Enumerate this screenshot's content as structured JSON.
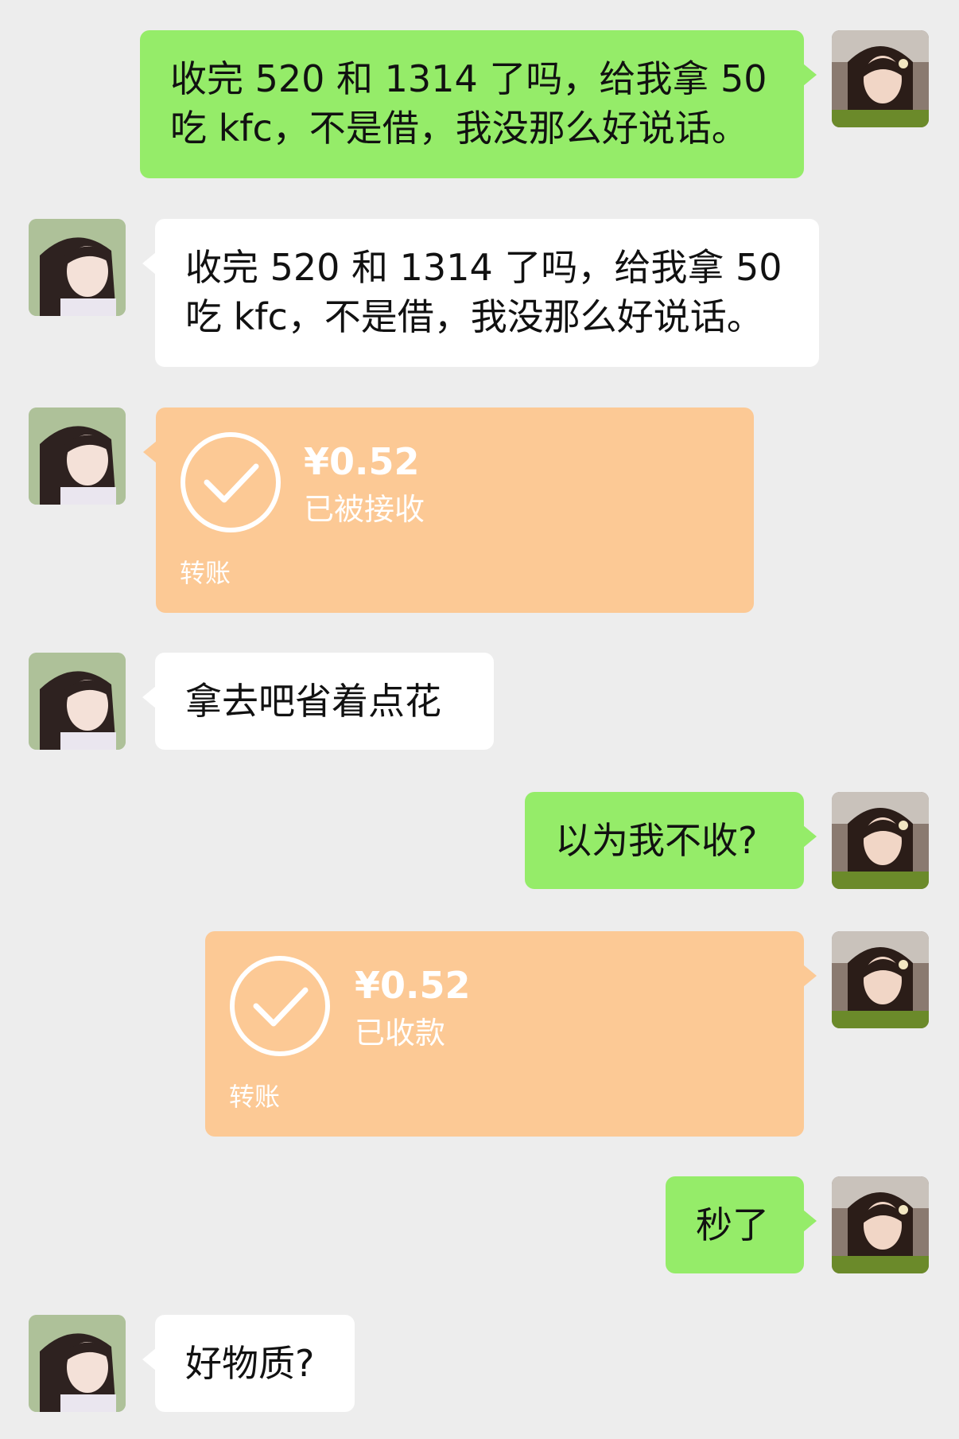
{
  "messages": [
    {
      "side": "right",
      "type": "text",
      "text": "收完 520 和 1314 了吗，给我拿 50\n吃 kfc，不是借，我没那么好说话。"
    },
    {
      "side": "left",
      "type": "text",
      "text": "收完 520 和 1314 了吗，给我拿 50\n吃 kfc，不是借，我没那么好说话。"
    },
    {
      "side": "left",
      "type": "transfer",
      "amount": "¥0.52",
      "status": "已被接收",
      "kind": "转账"
    },
    {
      "side": "left",
      "type": "text",
      "text": "拿去吧省着点花"
    },
    {
      "side": "right",
      "type": "text",
      "text": "以为我不收?"
    },
    {
      "side": "right",
      "type": "transfer",
      "amount": "¥0.52",
      "status": "已收款",
      "kind": "转账"
    },
    {
      "side": "right",
      "type": "text",
      "text": "秒了"
    },
    {
      "side": "left",
      "type": "text",
      "text": "好物质?"
    }
  ],
  "colors": {
    "background": "#ededed",
    "sent_bubble": "#95ec69",
    "received_bubble": "#ffffff",
    "transfer_card": "#fcc995"
  },
  "icons": {
    "transfer_status": "check-circle-icon",
    "self_avatar": "user-avatar-photo",
    "contact_avatar": "contact-avatar-photo"
  }
}
